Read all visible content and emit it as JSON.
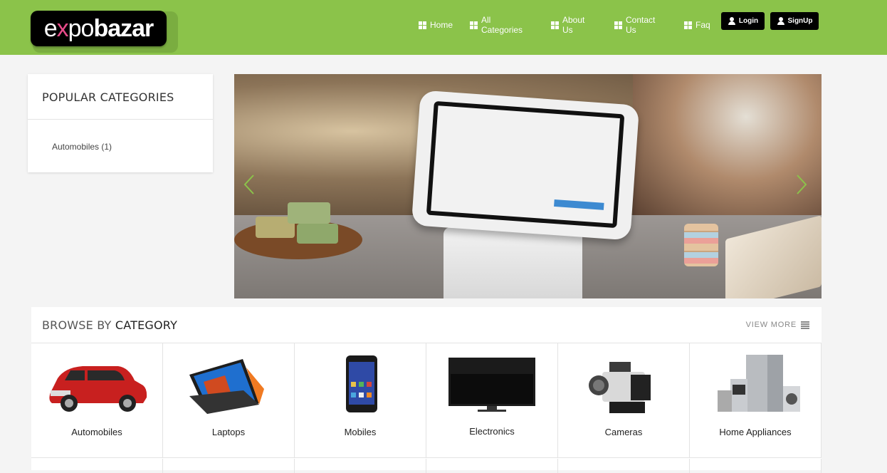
{
  "brand": {
    "logo_text_1": "e",
    "logo_text_x": "x",
    "logo_text_2": "po",
    "logo_text_3": "bazar"
  },
  "colors": {
    "header_bg": "#8bc34a",
    "button_bg": "#000000",
    "page_bg": "#f4f4f4"
  },
  "nav": {
    "items": [
      {
        "label": "Home",
        "icon": "grid-icon"
      },
      {
        "label": "All Categories",
        "icon": "grid-icon"
      },
      {
        "label": "About Us",
        "icon": "grid-icon"
      },
      {
        "label": "Contact Us",
        "icon": "grid-icon"
      },
      {
        "label": "Faq",
        "icon": "grid-icon"
      }
    ],
    "login_label": "Login",
    "signup_label": "SignUp"
  },
  "popular": {
    "title": "POPULAR CATEGORIES",
    "items": [
      {
        "label": "Automobiles (1)"
      }
    ]
  },
  "slider": {
    "icons": [
      "chevron-left-icon",
      "chevron-right-icon"
    ]
  },
  "browse": {
    "title_prefix": "BROWSE BY",
    "title_bold": "CATEGORY",
    "view_more": "VIEW MORE",
    "categories": [
      {
        "label": "Automobiles",
        "icon": "car-image"
      },
      {
        "label": "Laptops",
        "icon": "laptop-image"
      },
      {
        "label": "Mobiles",
        "icon": "phone-image"
      },
      {
        "label": "Electronics",
        "icon": "tv-image"
      },
      {
        "label": "Cameras",
        "icon": "camera-image"
      },
      {
        "label": "Home Appliances",
        "icon": "appliances-image"
      }
    ]
  }
}
